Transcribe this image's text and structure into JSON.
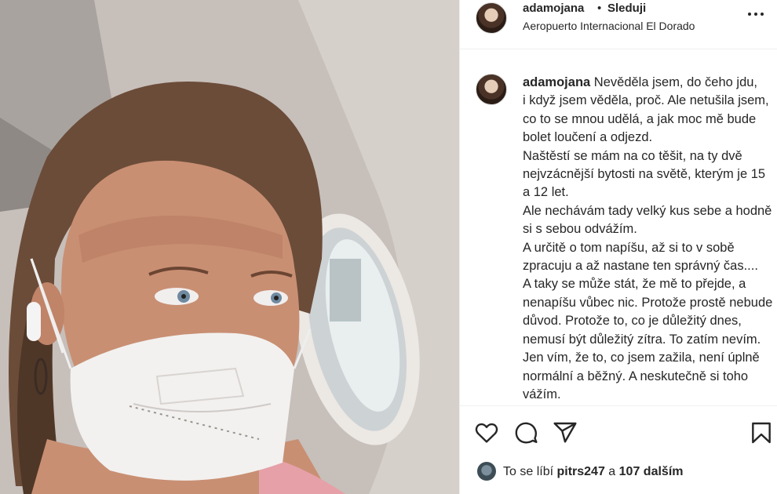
{
  "post": {
    "username": "adamojana",
    "separator": "•",
    "follow_label": "Sleduji",
    "location": "Aeropuerto Internacional El Dorado",
    "caption_username": "adamojana",
    "caption_text": "Nevěděla jsem, do čeho jdu,\ni když jsem věděla, proč. Ale netušila jsem, co to se mnou udělá, a jak moc mě bude bolet loučení a odjezd.\nNaštěstí se mám na co těšit, na ty dvě nejvzácnější bytosti na světě, kterým je 15 a 12 let.\nAle nechávám tady velký kus sebe a hodně si s sebou odvážím.\nA určitě o tom napíšu, až si to v sobě zpracuju a až nastane ten správný čas....\nA taky se může stát, že mě to přejde, a nenapíšu vůbec nic. Protože prostě nebude důvod. Protože to, co je důležitý dnes, nemusí být důležitý zítra. To zatím nevím. Jen vím, že to, co jsem zažila, není úplně normální a běžný. A neskutečně si toho vážím."
  },
  "likes": {
    "prefix": "To se líbí ",
    "liker": "pitrs247",
    "middle": " a ",
    "count": "107 dalším"
  },
  "icons": [
    "more-icon",
    "heart-icon",
    "comment-icon",
    "share-icon",
    "bookmark-icon"
  ]
}
